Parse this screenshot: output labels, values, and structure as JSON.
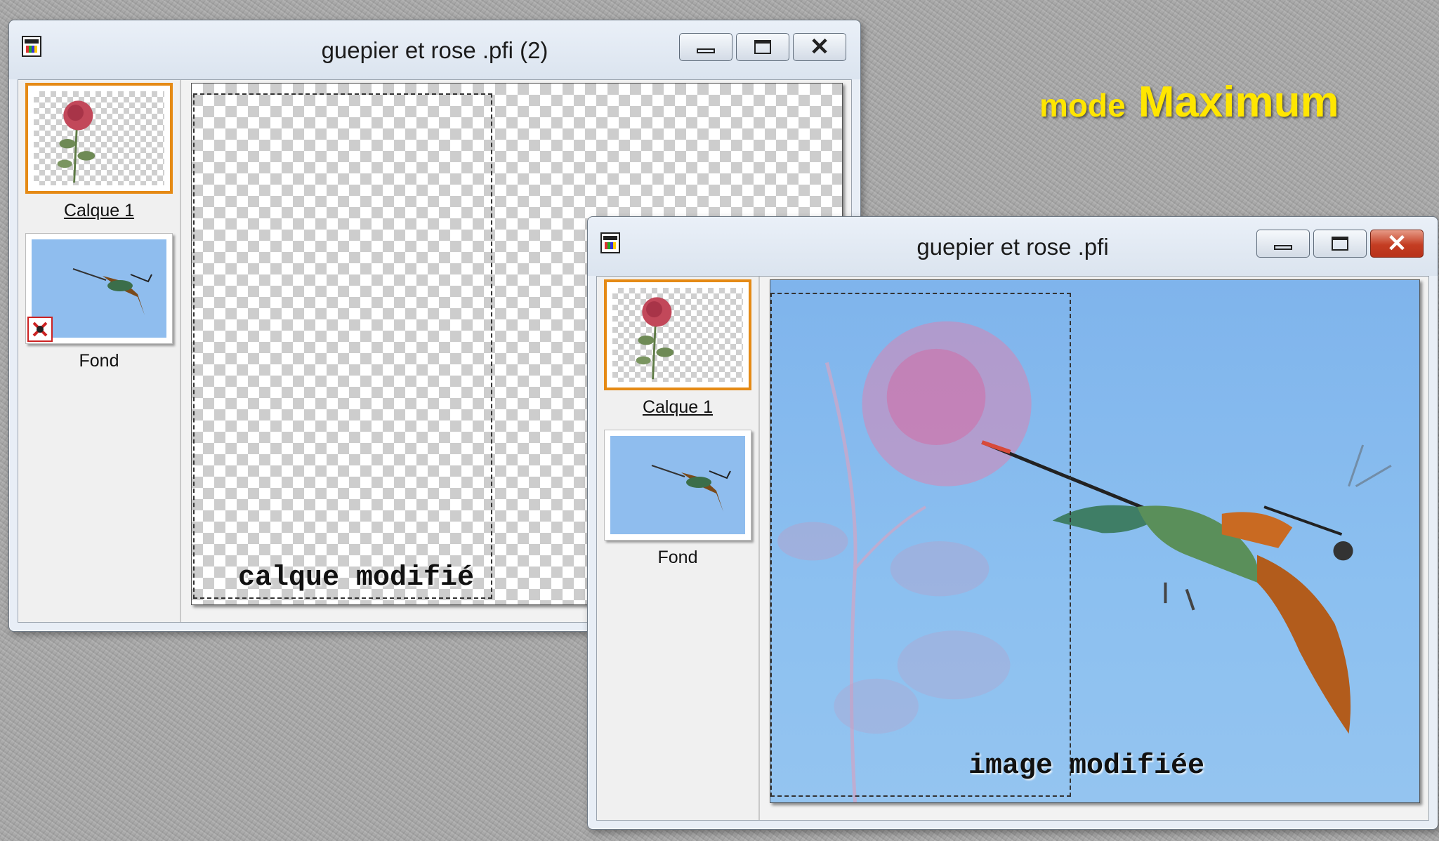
{
  "annotation": {
    "mode_word": "mode",
    "mode_name": "Maximum"
  },
  "window_back": {
    "title": "guepier et rose .pfi (2)",
    "buttons": {
      "minimize": "minimize-icon",
      "maximize": "maximize-icon",
      "close": "close-icon"
    },
    "layers": [
      {
        "label": "Calque 1",
        "thumbnail": "rose",
        "selected": true
      },
      {
        "label": "Fond",
        "thumbnail": "bee-eater",
        "selected": false,
        "badge": "hidden-layer-icon"
      }
    ],
    "canvas_caption": "calque modifié"
  },
  "window_front": {
    "title": "guepier et rose .pfi",
    "buttons": {
      "minimize": "minimize-icon",
      "maximize": "maximize-icon",
      "close": "close-icon"
    },
    "layers": [
      {
        "label": "Calque 1",
        "thumbnail": "rose",
        "selected": true
      },
      {
        "label": "Fond",
        "thumbnail": "bee-eater",
        "selected": false
      }
    ],
    "canvas_caption": "image modifiée"
  },
  "colors": {
    "selection_border": "#e58a15",
    "close_button": "#c43d22",
    "mode_text": "#ffe600",
    "sky": "#8fbdee"
  }
}
